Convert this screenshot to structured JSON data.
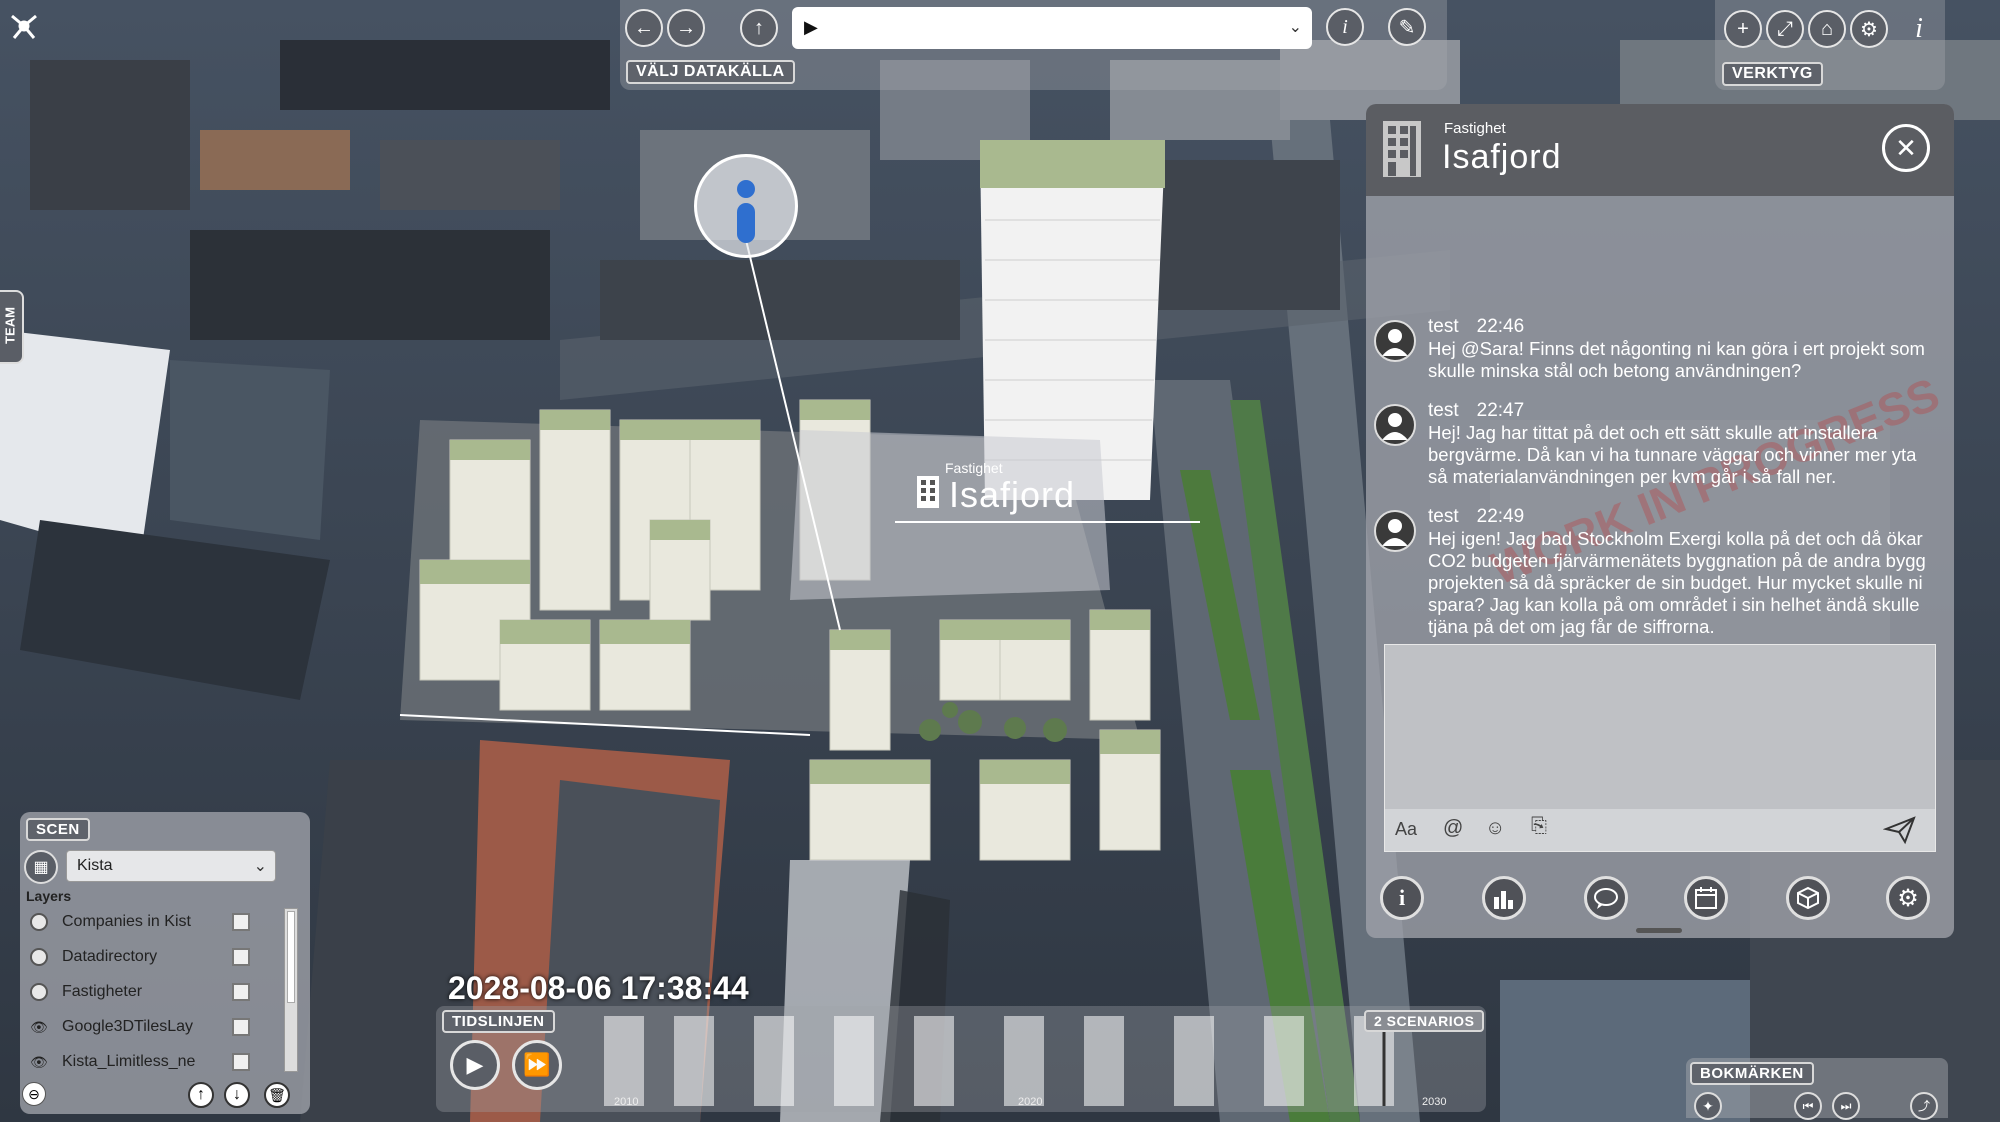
{
  "toolbar": {
    "data_source_tag": "VÄLJ DATAKÄLLA",
    "dropdown_value": "▶",
    "info_glyph": "i"
  },
  "tools": {
    "tag": "VERKTYG",
    "icons": [
      "plus-icon",
      "fullscreen-icon",
      "home-icon",
      "gear-icon",
      "info-icon"
    ]
  },
  "team_tab": "TEAM",
  "map_label": {
    "subtitle": "Fastighet",
    "title": "Isafjord"
  },
  "property_panel": {
    "subtitle": "Fastighet",
    "title": "Isafjord",
    "watermark": "WORK IN PROGRESS",
    "messages": [
      {
        "name": "test",
        "time": "22:46",
        "text": "Hej @Sara! Finns det någonting ni kan göra i ert projekt som skulle minska stål och betong användningen?"
      },
      {
        "name": "test",
        "time": "22:47",
        "text": "Hej! Jag har tittat på det och ett sätt skulle att installera bergvärme. Då kan vi ha tunnare väggar och vinner mer yta så materialanvändningen per kvm går i så fall ner."
      },
      {
        "name": "test",
        "time": "22:49",
        "text": "Hej igen! Jag bad Stockholm Exergi kolla på det och då ökar CO2 budgeten fjärvärmenätets byggnation på de andra bygg projekten så då spräcker de sin budget. Hur mycket skulle ni spara?  Jag kan kolla på om området i sin helhet ändå skulle tjäna på det om jag får de siffrorna."
      }
    ],
    "input_value": "",
    "format_label": "Aa",
    "mention_label": "@",
    "footer_icons": [
      "info-icon",
      "chart-icon",
      "chat-icon",
      "calendar-icon",
      "cube-icon",
      "gear-icon"
    ]
  },
  "scene_panel": {
    "tag": "SCEN",
    "select_value": "Kista",
    "layers_heading": "Layers",
    "layers": [
      {
        "name": "Companies in Kist",
        "visible": false
      },
      {
        "name": "Datadirectory",
        "visible": false
      },
      {
        "name": "Fastigheter",
        "visible": false
      },
      {
        "name": "Google3DTilesLay",
        "visible": true
      },
      {
        "name": "Kista_Limitless_ne",
        "visible": true
      }
    ]
  },
  "timeline": {
    "datetime": "2028-08-06 17:38:44",
    "tag": "TIDSLINJEN",
    "scenarios_tag": "2 SCENARIOS",
    "years": [
      "2010",
      "2020",
      "2030"
    ]
  },
  "bookmarks": {
    "tag": "BOKMÄRKEN"
  },
  "colors": {
    "panel_bg": "#9ea1a8",
    "panel_header": "#5b5d62",
    "accent_blue": "#2f6fcf"
  }
}
